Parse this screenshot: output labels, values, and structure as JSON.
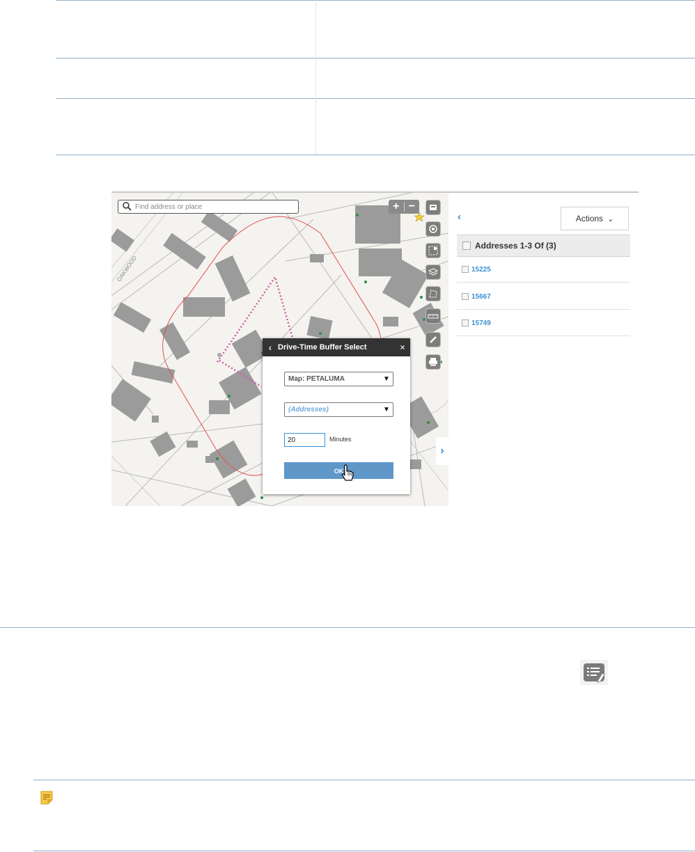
{
  "map": {
    "search_placeholder": "Find address or place",
    "zoom_in": "+",
    "zoom_out": "−",
    "street_label": "OAKWOOD",
    "tools": [
      "basemap-icon",
      "locate-icon",
      "select-icon",
      "layers-icon",
      "draw-polygon-icon",
      "measure-icon",
      "edit-icon",
      "print-icon"
    ]
  },
  "dialog": {
    "back": "‹",
    "title": "Drive-Time Buffer Select",
    "close": "×",
    "map_select": "Map: PETALUMA",
    "layer_select": "(Addresses)",
    "minutes_value": "20",
    "minutes_label": "Minutes",
    "ok_label": "OK"
  },
  "panel": {
    "back": "‹",
    "actions_label": "Actions",
    "actions_caret": "⌄",
    "header": "Addresses 1-3 Of (3)",
    "results": [
      "15225",
      "15667",
      "15749"
    ],
    "expand": "›"
  },
  "colors": {
    "accent": "#3b8fd4",
    "ok_button": "#5f97c9",
    "buffer_outline": "#e05050",
    "route_dotted": "#d45aa6",
    "buildings": "#9b9b9b",
    "rule_line": "#8fb0c8"
  }
}
